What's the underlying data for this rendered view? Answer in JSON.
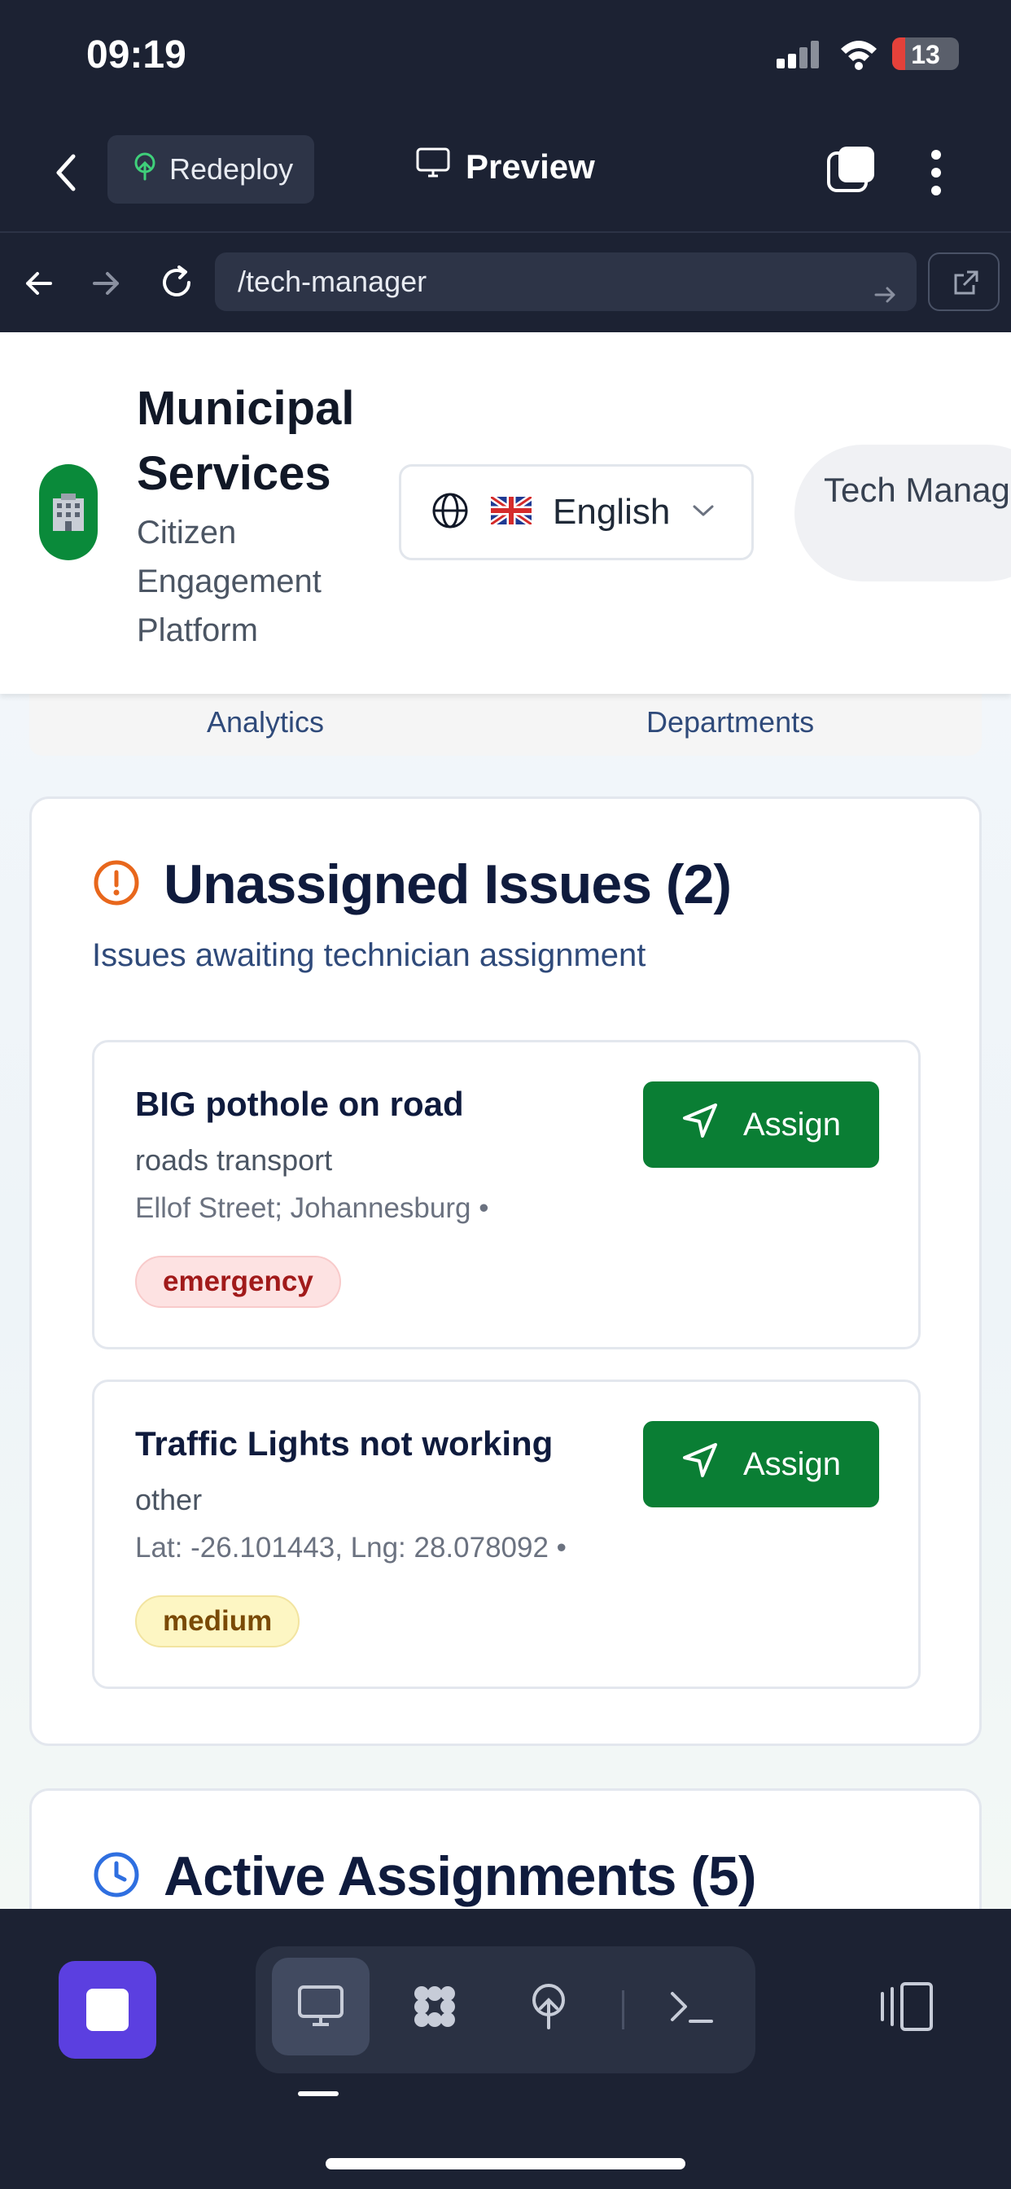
{
  "status_bar": {
    "time": "09:19",
    "battery_level": "13",
    "icons": [
      "signal-icon",
      "wifi-icon",
      "battery-icon"
    ]
  },
  "app_bar": {
    "redeploy_label": "Redeploy",
    "preview_label": "Preview",
    "icons": [
      "back-chevron-icon",
      "redeploy-icon",
      "monitor-icon",
      "tabs-icon",
      "more-vertical-icon"
    ]
  },
  "url_bar": {
    "url": "/tech-manager",
    "icons": [
      "arrow-left-icon",
      "arrow-right-icon",
      "reload-icon",
      "go-arrow-icon",
      "external-link-icon"
    ]
  },
  "site_header": {
    "title": "Municipal Services",
    "subtitle": "Citizen Engagement Platform",
    "logo": "municipal-building-icon",
    "language": {
      "selected": "English",
      "flag": "uk-flag-icon"
    },
    "role": "Tech Manager"
  },
  "nav": {
    "items": [
      "Analytics",
      "Departments"
    ]
  },
  "unassigned": {
    "title": "Unassigned Issues (2)",
    "subtitle": "Issues awaiting technician assignment",
    "icon": "alert-circle-icon",
    "accent": "#e8671c",
    "issues": [
      {
        "title": "BIG pothole on road",
        "category": "roads transport",
        "location": "Ellof Street; Johannesburg •",
        "priority": "emergency",
        "action": "Assign"
      },
      {
        "title": "Traffic Lights not working",
        "category": "other",
        "location": "Lat: -26.101443, Lng: 28.078092 •",
        "priority": "medium",
        "action": "Assign"
      }
    ]
  },
  "active": {
    "title": "Active Assignments (5)",
    "icon": "clock-icon",
    "accent": "#2f6fe0"
  },
  "colors": {
    "assign_button": "#0a7e34",
    "emergency_badge_bg": "#fde2e2",
    "medium_badge_bg": "#fdf6c3",
    "stop_button": "#5b3fe0"
  },
  "bottom_toolbar": {
    "icons": [
      "stop-icon",
      "preview-monitor-icon",
      "workflow-icon",
      "deploy-icon",
      "terminal-icon",
      "panel-toggle-icon"
    ],
    "active_tool": "preview-monitor-icon"
  }
}
